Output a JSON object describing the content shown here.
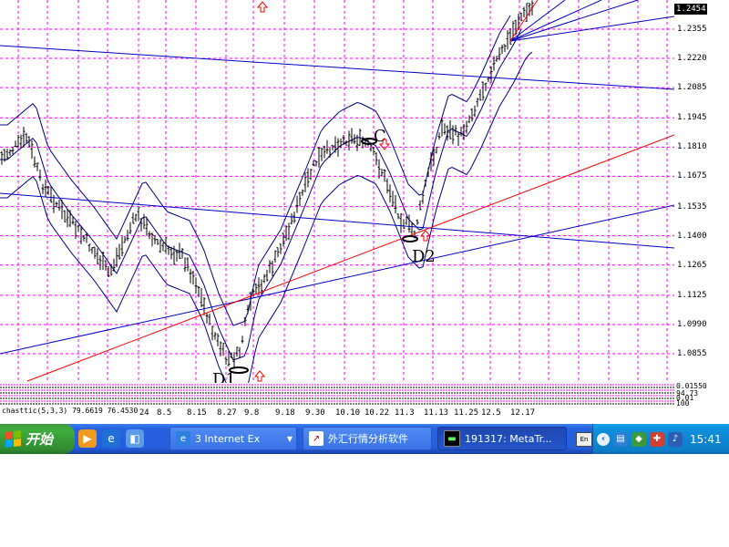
{
  "chart": {
    "price_ticks": [
      "1.2355",
      "1.2220",
      "1.2085",
      "1.1945",
      "1.1810",
      "1.1675",
      "1.1535",
      "1.1400",
      "1.1265",
      "1.1125",
      "1.0990",
      "1.0855"
    ],
    "current_price": "1.2454",
    "date_ticks": [
      {
        "label": "7.24"
      },
      {
        "label": "8.5"
      },
      {
        "label": "8.15"
      },
      {
        "label": "8.27"
      },
      {
        "label": "9.8"
      },
      {
        "label": "9.18"
      },
      {
        "label": "9.30"
      },
      {
        "label": "10.10"
      },
      {
        "label": "10.22"
      },
      {
        "label": "11.3"
      },
      {
        "label": "11.13"
      },
      {
        "label": "11.25"
      },
      {
        "label": "12.5"
      },
      {
        "label": "12.17"
      }
    ],
    "annotations": {
      "d1": "D1",
      "d2": "D2",
      "c": "C"
    },
    "bar_color": "#000000",
    "grid_color": "#ff00ff",
    "trendline_color": "#0000cc",
    "red_line_color": "#ff0000",
    "arrow_color": "#ff0000"
  },
  "indicator": {
    "label": "chasttic(5,3,3) 79.6619 76.4530",
    "scale": [
      "94.73",
      "0.01",
      "100"
    ],
    "top_value": "0.01550"
  },
  "taskbar": {
    "start_label": "开始",
    "quick_launch": [
      "media-player-icon",
      "ie-icon",
      "show-desktop-icon"
    ],
    "tasks": [
      {
        "label": "3 Internet Ex",
        "icon": "ie-icon",
        "active": false
      },
      {
        "label": "外汇行情分析软件",
        "icon": "chart-app-icon",
        "active": false
      },
      {
        "label": "191317: MetaTr...",
        "icon": "metatrader-icon",
        "active": true
      }
    ],
    "clock": "15:41",
    "kbd_label": "En"
  }
}
